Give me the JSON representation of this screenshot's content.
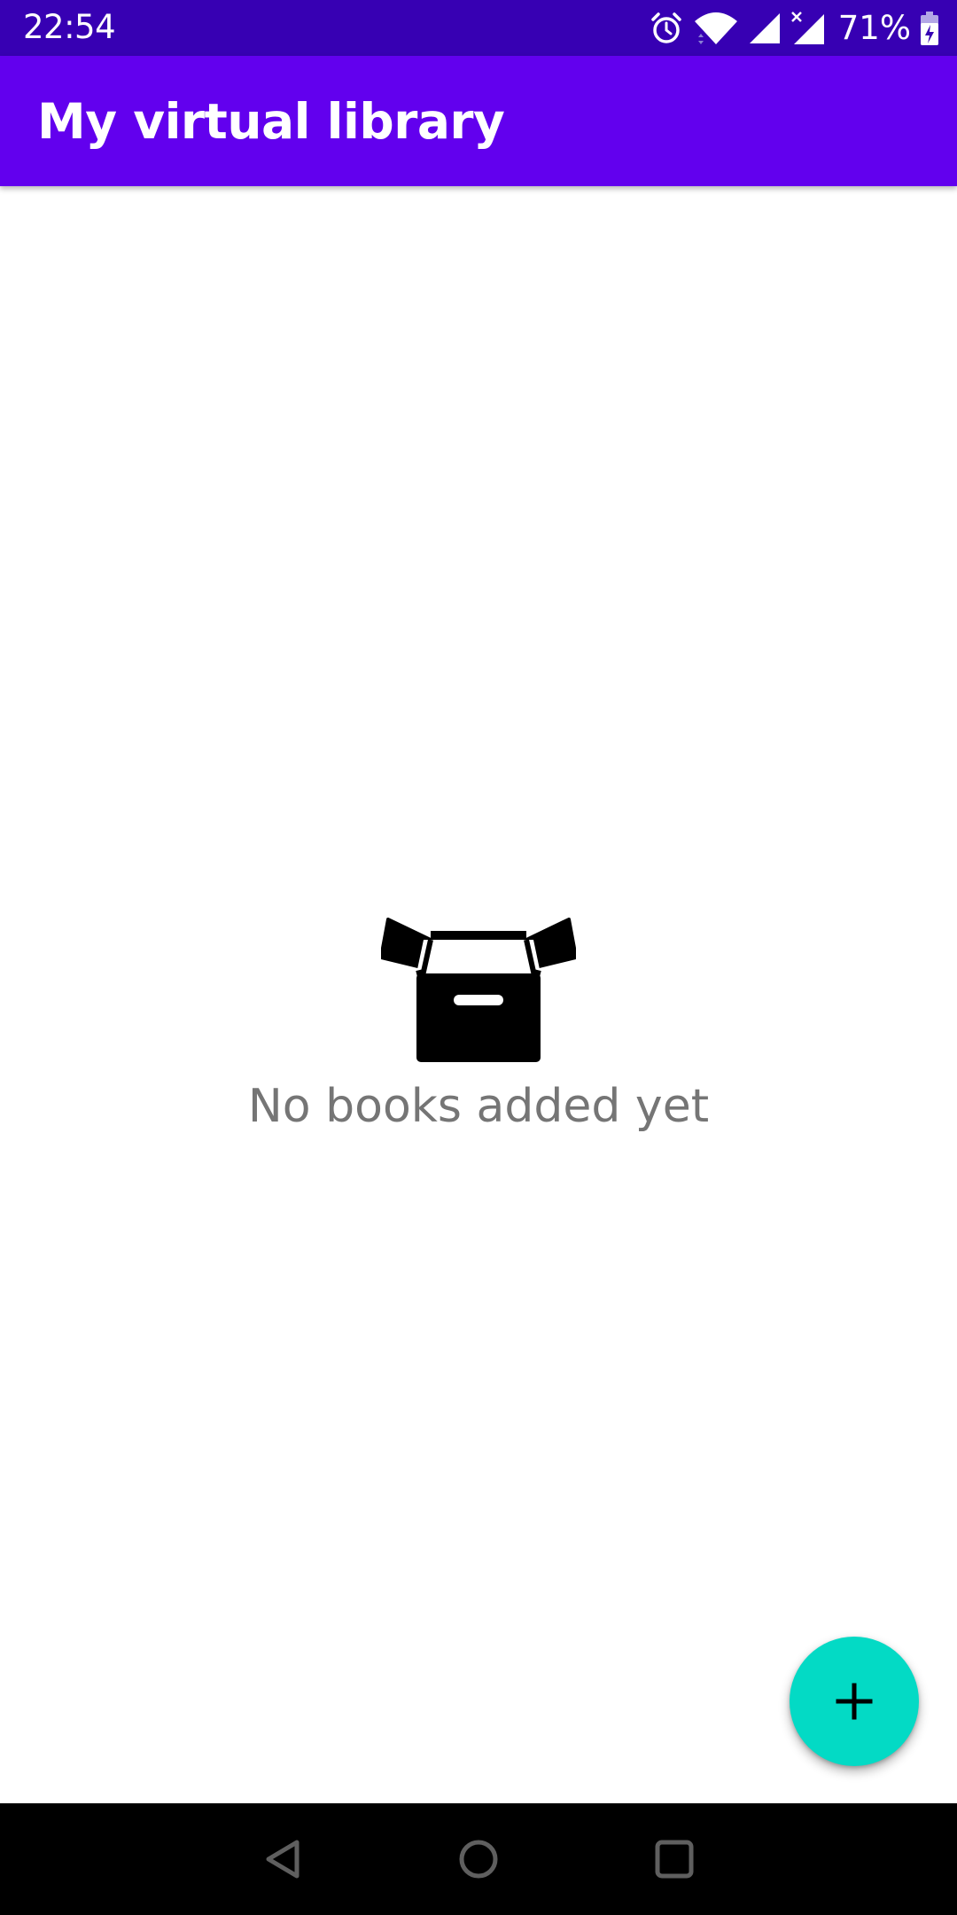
{
  "status_bar": {
    "time": "22:54",
    "battery_percent": "71%",
    "icons": [
      "alarm-icon",
      "wifi-icon",
      "signal-icon",
      "signal-no-data-icon",
      "battery-charging-icon"
    ]
  },
  "app_bar": {
    "title": "My virtual library"
  },
  "empty_state": {
    "icon": "open-box-icon",
    "message": "No books added yet"
  },
  "fab": {
    "icon": "plus-icon"
  },
  "nav_bar": {
    "buttons": [
      "back-icon",
      "home-icon",
      "recents-icon"
    ]
  },
  "colors": {
    "status_bar": "#3700b3",
    "app_bar": "#6200ee",
    "fab": "#03dac5",
    "empty_text": "#757575",
    "nav_bar": "#000000"
  }
}
